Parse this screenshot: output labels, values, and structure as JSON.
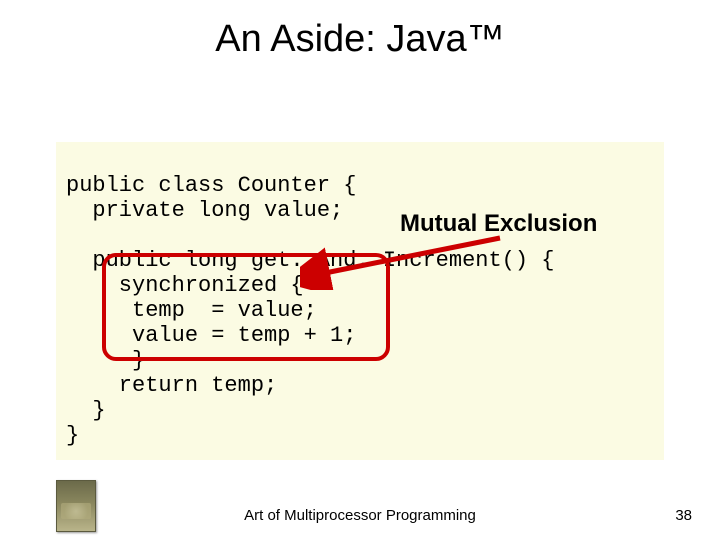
{
  "title": "An Aside: Java™",
  "code": {
    "l1": "public class Counter {",
    "l2": "  private long value;",
    "l3": "",
    "l4": "  public long get. And. Increment() {",
    "l5": "    synchronized {",
    "l6": "     temp  = value;",
    "l7": "     value = temp + 1;",
    "l8": "     }",
    "l9": "    return temp;",
    "l10": "  }",
    "l11": "}"
  },
  "annotation": {
    "label": "Mutual Exclusion"
  },
  "footer": {
    "text": "Art of Multiprocessor Programming",
    "page": "38"
  }
}
